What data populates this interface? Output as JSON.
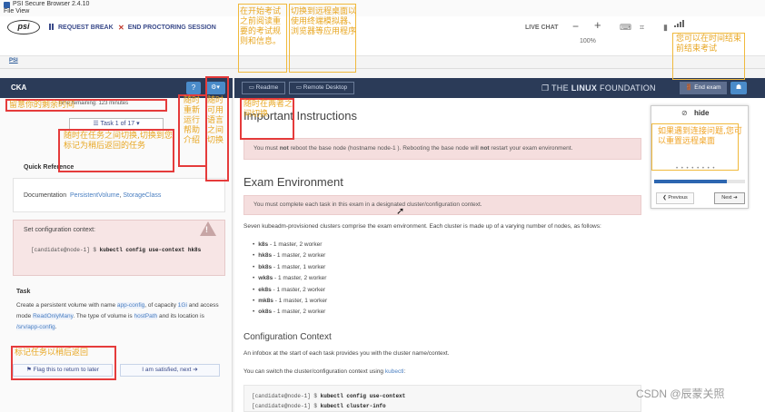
{
  "window": {
    "title": "PSI Secure Browser 2.4.10",
    "menu": "File  View"
  },
  "toolbar": {
    "logo": "psi",
    "pause_label": "REQUEST BREAK",
    "end_label": "END PROCTORING SESSION",
    "live_chat": "LIVE CHAT",
    "zoom_minus": "−",
    "zoom_plus": "+",
    "zoom_pct": "100%",
    "tab_label": "PSI"
  },
  "left": {
    "exam_name": "CKA",
    "timer": "Time remaining: 123 minutes",
    "task_select": "☰ Task 1 of 17 ▾",
    "quick_ref_title": "Quick Reference",
    "ref_prefix": "Documentation",
    "ref_link1": "PersistentVolume",
    "ref_sep": ",",
    "ref_link2": "StorageClass",
    "ctx_label": "Set configuration context:",
    "ctx_prompt": "[candidate@node-1] $",
    "ctx_cmd": "kubectl config use-context hk8s",
    "task_label": "Task",
    "task_t1": "Create a persistent volume with name",
    "task_name": "app-config",
    "task_t2": ", of capacity",
    "task_cap": "1Gi",
    "task_t3": "and access mode",
    "task_mode": "ReadOnlyMany",
    "task_t4": ". The type of volume is",
    "task_type": "hostPath",
    "task_t5": "and its location is",
    "task_path": "/srv/app-config",
    "task_t6": ".",
    "flag_btn": "⚑ Flag this to return to later",
    "sat_btn": "I am satisfied, next ➔"
  },
  "main": {
    "readme_btn": "▭ Readme",
    "remote_btn": "▭ Remote Desktop",
    "brand_pre": "❐ THE ",
    "brand_bold": "LINUX",
    "brand_post": " FOUNDATION",
    "end_exam": "🚪 End exam",
    "menu_btn": "☗",
    "h1": "Important Instructions",
    "note1_pre": "You must",
    "note1_b1": "not",
    "note1_mid": "reboot the base node (hostname   node-1 ). Rebooting the base node will",
    "note1_b2": "not",
    "note1_post": "restart your exam environment.",
    "h2": "Exam Environment",
    "note2": "You must complete each task in this exam in a designated cluster/configuration context.",
    "para1": "Seven kubeadm-provisioned clusters comprise the exam environment. Each cluster is made up of a varying number of nodes, as follows:",
    "clusters": [
      {
        "name": "k8s",
        "desc": " - 1 master, 2 worker"
      },
      {
        "name": "hk8s",
        "desc": " - 1 master, 2 worker"
      },
      {
        "name": "bk8s",
        "desc": " - 1 master, 1 worker"
      },
      {
        "name": "wk8s",
        "desc": " - 1 master, 2 worker"
      },
      {
        "name": "ek8s",
        "desc": " - 1 master, 2 worker"
      },
      {
        "name": "mk8s",
        "desc": " - 1 master, 1 worker"
      },
      {
        "name": "ok8s",
        "desc": " - 1 master, 2 worker"
      }
    ],
    "h3": "Configuration Context",
    "para2": "An infobox at the start of each task provides you with the cluster name/context.",
    "para3_pre": "You can switch the cluster/configuration context using",
    "para3_hl": "kubectl",
    "para3_post": ":",
    "code1_prompt": "[candidate@node-1] $",
    "code1_cmd": "kubectl config use-context",
    "code2_prompt": "[candidate@node-1] $",
    "code2_cmd": "kubectl cluster-info"
  },
  "popup": {
    "hide": "hide",
    "dots": "• • • • • • • •",
    "progress": 0.8,
    "prev": "❮ Previous",
    "next": "Next ➔"
  },
  "annotations": {
    "time": "留意你的剩余时间",
    "switch": "随时在任务之间切换,切换到您标记为稍后返回的任务",
    "help": "随时重新运行帮助介绍",
    "lang": "随时可用语言之间切换",
    "readme": "在开始考试之前阅读重要的考试规则和信息。",
    "remote": "切换到远程桌面以使用终端模拟器、浏览器等应用程序",
    "switch2": "随时在两者之间切换",
    "end": "您可以在时间结束前结束考试",
    "popup": "如果遇到连接问题,您可以重置远程桌面",
    "flag": "标记任务以稍后返回"
  },
  "watermark": "CSDN @辰蒙关照"
}
